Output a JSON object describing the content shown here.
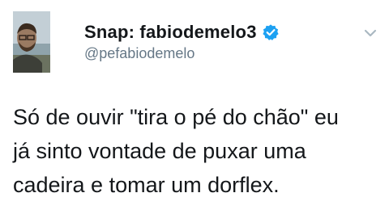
{
  "tweet": {
    "display_name": "Snap: fabiodemelo3",
    "handle": "@pefabiodemelo",
    "verified": true,
    "text": "Só de ouvir \"tira o pé do chão\" eu\njá sinto vontade de puxar uma\ncadeira e tomar um dorflex.",
    "icons": {
      "verified": "verified-badge-icon",
      "menu": "chevron-down-icon"
    },
    "colors": {
      "verified_badge": "#1da1f2",
      "handle": "#657786",
      "text": "#14171a",
      "chevron": "#aab8c2"
    }
  }
}
